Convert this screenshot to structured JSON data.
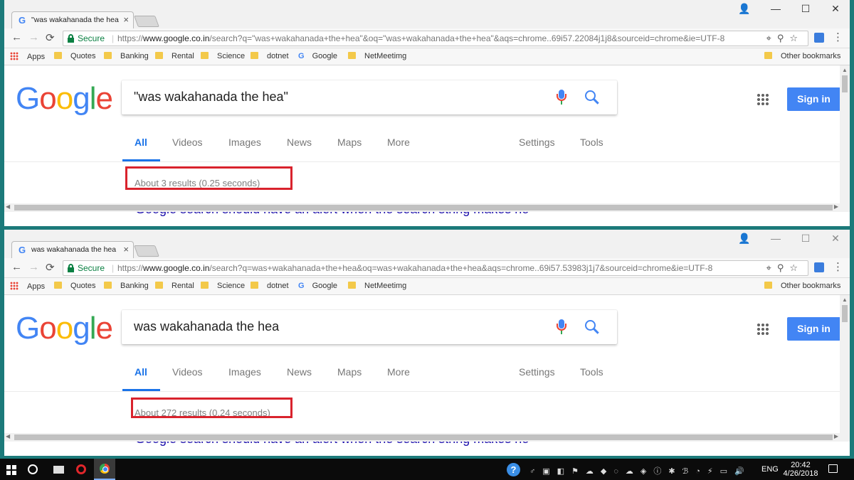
{
  "brand": {
    "g_blue": "#4285F4",
    "g_red": "#EA4335",
    "g_yellow": "#FBBC05",
    "g_green": "#34A853",
    "highlight_red": "#D9232D"
  },
  "google_logo": [
    "G",
    "o",
    "o",
    "g",
    "l",
    "e"
  ],
  "nav_labels": {
    "back": "←",
    "forward": "→",
    "reload": "⟳",
    "menu": "⋮"
  },
  "window_controls": {
    "user": "👤",
    "minimize": "—",
    "maximize": "☐",
    "close": "✕"
  },
  "bookmarks": {
    "items": [
      "Apps",
      "Quotes",
      "Banking",
      "Rental",
      "Science",
      "dotnet",
      "Google",
      "NetMeetimg"
    ],
    "other": "Other bookmarks"
  },
  "windows": [
    {
      "tab_title": "\"was wakahanada the hea",
      "tab_close": "×",
      "secure_label": "Secure",
      "url_scheme": "https://",
      "url_host": "www.google.co.in",
      "url_rest": "/search?q=\"was+wakahanada+the+hea\"&oq=\"was+wakahanada+the+hea\"&aqs=chrome..69i57.22084j1j8&sourceid=chrome&ie=UTF-8",
      "search_query": "\"was wakahanada the hea\"",
      "tabs": [
        "All",
        "Videos",
        "Images",
        "News",
        "Maps",
        "More",
        "Settings",
        "Tools"
      ],
      "result_stats": "About 3 results (0.25 seconds)",
      "result_link": "Google search should have an alert when the search string makes no"
    },
    {
      "tab_title": "was wakahanada the hea",
      "tab_close": "×",
      "secure_label": "Secure",
      "url_scheme": "https://",
      "url_host": "www.google.co.in",
      "url_rest": "/search?q=was+wakahanada+the+hea&oq=was+wakahanada+the+hea&aqs=chrome..69i57.53983j1j7&sourceid=chrome&ie=UTF-8",
      "search_query": "was wakahanada the hea",
      "tabs": [
        "All",
        "Videos",
        "Images",
        "News",
        "Maps",
        "More",
        "Settings",
        "Tools"
      ],
      "result_stats": "About 272 results (0.24 seconds)",
      "result_link": "Google search should have an alert when the search string makes no"
    }
  ],
  "sign_in_label": "Sign in",
  "taskbar": {
    "help_label": "?",
    "language": "ENG",
    "time": "20:42",
    "date": "4/26/2018"
  }
}
